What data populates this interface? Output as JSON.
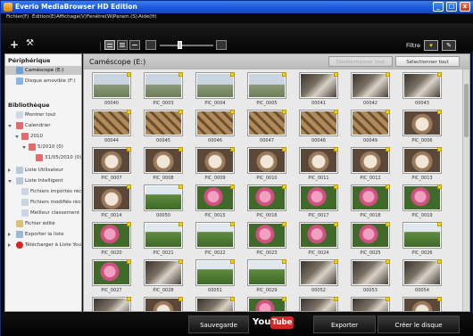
{
  "window": {
    "title": "Everio MediaBrowser HD Edition",
    "controls": {
      "minimize": "_",
      "maximize": "□",
      "close": "x"
    }
  },
  "menubar": {
    "items": [
      "Fichier(F)",
      "Édition(E)",
      "Affichage(V)",
      "Fenêtre(W)",
      "Param.(S)",
      "Aide(H)"
    ]
  },
  "toolbar": {
    "add_glyph": "+",
    "tools_glyph": "⚒",
    "filter_label": "Filtre",
    "filter_glyph": "▾",
    "edit_glyph": "✎"
  },
  "sidebar": {
    "peripherique_title": "Périphérique",
    "devices": [
      {
        "label": "Caméscope (E:)",
        "icon": "camcorder-icon",
        "selected": true
      },
      {
        "label": "Disque amovible (F:)",
        "icon": "removable-disk-icon",
        "selected": false
      }
    ],
    "bibliotheque_title": "Bibliothèque",
    "library": [
      {
        "label": "Montrer tout"
      },
      {
        "label": "Calendrier"
      },
      {
        "label": "2010"
      },
      {
        "label": "5/2010 (0)"
      },
      {
        "label": "31/05/2010 (0)"
      },
      {
        "label": "Liste Utilisateur"
      },
      {
        "label": "Liste Intelligent"
      },
      {
        "label": "Fichiers importés réce"
      },
      {
        "label": "Fichiers modifiés réce"
      },
      {
        "label": "Meilleur classement"
      },
      {
        "label": "Fichier édité"
      },
      {
        "label": "Exporter la liste"
      },
      {
        "label": "Télécharger à Liste YouT"
      }
    ]
  },
  "main": {
    "title": "Caméscope (E:)",
    "deselect_label": "Désélectionner tout",
    "select_all_label": "Sélectionner tout",
    "thumbnails": [
      {
        "label": "00040",
        "kind": "landscape"
      },
      {
        "label": "PIC_0003",
        "kind": "landscape"
      },
      {
        "label": "PIC_0004",
        "kind": "landscape"
      },
      {
        "label": "PIC_0005",
        "kind": "landscape"
      },
      {
        "label": "00041",
        "kind": "room"
      },
      {
        "label": "00042",
        "kind": "room"
      },
      {
        "label": "00043",
        "kind": "room"
      },
      {
        "label": "00044",
        "kind": "floor"
      },
      {
        "label": "00045",
        "kind": "floor"
      },
      {
        "label": "00046",
        "kind": "floor"
      },
      {
        "label": "00047",
        "kind": "floor"
      },
      {
        "label": "00048",
        "kind": "floor"
      },
      {
        "label": "00049",
        "kind": "floor"
      },
      {
        "label": "PIC_0006",
        "kind": "cat"
      },
      {
        "label": "PIC_0007",
        "kind": "cat"
      },
      {
        "label": "PIC_0008",
        "kind": "cat"
      },
      {
        "label": "PIC_0009",
        "kind": "cat"
      },
      {
        "label": "PIC_0010",
        "kind": "cat"
      },
      {
        "label": "PIC_0011",
        "kind": "cat"
      },
      {
        "label": "PIC_0012",
        "kind": "cat"
      },
      {
        "label": "PIC_0013",
        "kind": "cat"
      },
      {
        "label": "PIC_0014",
        "kind": "cat"
      },
      {
        "label": "00050",
        "kind": "garden"
      },
      {
        "label": "PIC_0015",
        "kind": "rose"
      },
      {
        "label": "PIC_0016",
        "kind": "rose"
      },
      {
        "label": "PIC_0017",
        "kind": "rose"
      },
      {
        "label": "PIC_0018",
        "kind": "rose"
      },
      {
        "label": "PIC_0019",
        "kind": "rose"
      },
      {
        "label": "PIC_0020",
        "kind": "rose"
      },
      {
        "label": "PIC_0021",
        "kind": "garden"
      },
      {
        "label": "PIC_0022",
        "kind": "garden"
      },
      {
        "label": "PIC_0023",
        "kind": "rose"
      },
      {
        "label": "PIC_0024",
        "kind": "rose"
      },
      {
        "label": "PIC_0025",
        "kind": "rose"
      },
      {
        "label": "PIC_0026",
        "kind": "garden"
      },
      {
        "label": "PIC_0027",
        "kind": "rose"
      },
      {
        "label": "PIC_0028",
        "kind": "room"
      },
      {
        "label": "00051",
        "kind": "garden"
      },
      {
        "label": "PIC_0029",
        "kind": "garden"
      },
      {
        "label": "00052",
        "kind": "room"
      },
      {
        "label": "00053",
        "kind": "room"
      },
      {
        "label": "00054",
        "kind": "room"
      },
      {
        "label": "",
        "kind": "room"
      },
      {
        "label": "",
        "kind": "cat"
      },
      {
        "label": "",
        "kind": "room"
      },
      {
        "label": "",
        "kind": "rose"
      },
      {
        "label": "",
        "kind": "room"
      },
      {
        "label": "",
        "kind": "room"
      },
      {
        "label": "",
        "kind": "cat"
      }
    ]
  },
  "bottombar": {
    "save_label": "Sauvegarde",
    "youtube_you": "You",
    "youtube_tube": "Tube",
    "export_label": "Exporter",
    "create_disc_label": "Créer le disque"
  },
  "colors": {
    "xp_title_blue": "#1a56d8",
    "selected_item": "#c8c8c8",
    "flag_yellow": "#f3d21b",
    "youtube_red": "#d62525"
  }
}
